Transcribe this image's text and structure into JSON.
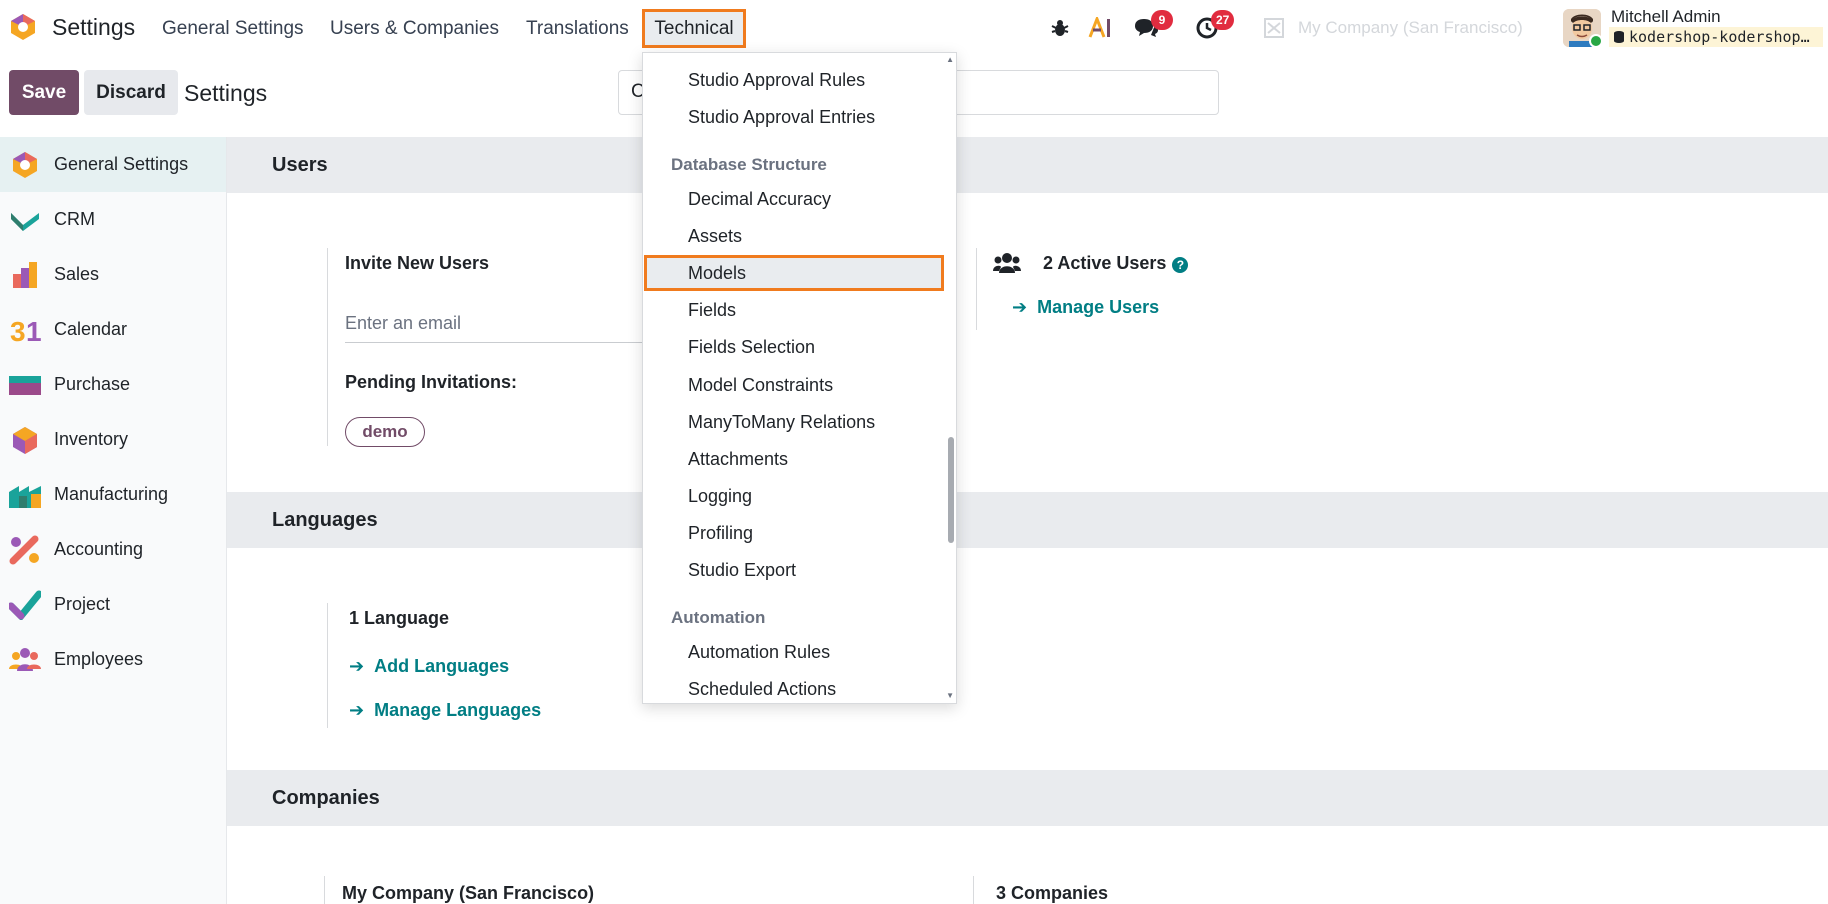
{
  "navbar": {
    "app_title": "Settings",
    "menus": [
      "General Settings",
      "Users & Companies",
      "Translations"
    ],
    "active_menu": "Technical",
    "messages_count": "9",
    "activities_count": "27",
    "company_name": "My Company (San Francisco)",
    "user_name": "Mitchell Admin",
    "database": "kodershop-kodershop…"
  },
  "control_panel": {
    "save_label": "Save",
    "discard_label": "Discard",
    "title": "Settings",
    "search_value": "C"
  },
  "sidebar": {
    "items": [
      {
        "label": "General Settings",
        "icon": "settings-logo-icon"
      },
      {
        "label": "CRM",
        "icon": "crm-icon"
      },
      {
        "label": "Sales",
        "icon": "sales-icon"
      },
      {
        "label": "Calendar",
        "icon": "calendar-icon"
      },
      {
        "label": "Purchase",
        "icon": "purchase-icon"
      },
      {
        "label": "Inventory",
        "icon": "inventory-icon"
      },
      {
        "label": "Manufacturing",
        "icon": "manufacturing-icon"
      },
      {
        "label": "Accounting",
        "icon": "accounting-icon"
      },
      {
        "label": "Project",
        "icon": "project-icon"
      },
      {
        "label": "Employees",
        "icon": "employees-icon"
      }
    ]
  },
  "users_section": {
    "title": "Users",
    "invite_label": "Invite New Users",
    "email_placeholder": "Enter an email",
    "pending_label": "Pending Invitations:",
    "pending_tag": "demo",
    "active_users": "2 Active Users",
    "manage_users": "Manage Users"
  },
  "languages_section": {
    "title": "Languages",
    "count_label": "1 Language",
    "add_languages": "Add Languages",
    "manage_languages": "Manage Languages"
  },
  "companies_section": {
    "title": "Companies",
    "company_name": "My Company (San Francisco)",
    "count_label": "3 Companies"
  },
  "dropdown": {
    "items_top": [
      "Studio Approval Rules",
      "Studio Approval Entries"
    ],
    "header_db": "Database Structure",
    "items_db": [
      "Decimal Accuracy",
      "Assets",
      "Models",
      "Fields",
      "Fields Selection",
      "Model Constraints",
      "ManyToMany Relations",
      "Attachments",
      "Logging",
      "Profiling",
      "Studio Export"
    ],
    "highlighted": "Models",
    "header_auto": "Automation",
    "items_auto": [
      "Automation Rules",
      "Scheduled Actions"
    ]
  },
  "colors": {
    "brand": "#714b67",
    "link": "#017e84",
    "highlight_outline": "#f07b1e",
    "badge": "#e12c3f"
  }
}
